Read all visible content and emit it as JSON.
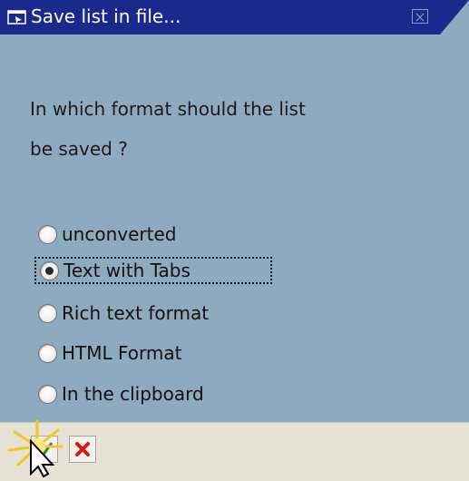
{
  "window": {
    "title": "Save list in file...",
    "title_icon": "window-pointer-icon",
    "close_icon": "close-icon"
  },
  "prompt": {
    "line1": "In which format should the list",
    "line2": "be saved ?"
  },
  "format_options": [
    {
      "label": "unconverted",
      "selected": false
    },
    {
      "label": "Text with Tabs",
      "selected": true
    },
    {
      "label": "Rich text format",
      "selected": false
    },
    {
      "label": "HTML Format",
      "selected": false
    },
    {
      "label": "In the clipboard",
      "selected": false
    }
  ],
  "toolbar": {
    "confirm_icon": "checkmark-icon",
    "cancel_icon": "red-x-icon"
  },
  "colors": {
    "titlebar": "#1a2a8c",
    "dialog_background": "#8eaabf",
    "toolbar_background": "#e6e3d6",
    "cancel_red": "#d41a1a"
  }
}
